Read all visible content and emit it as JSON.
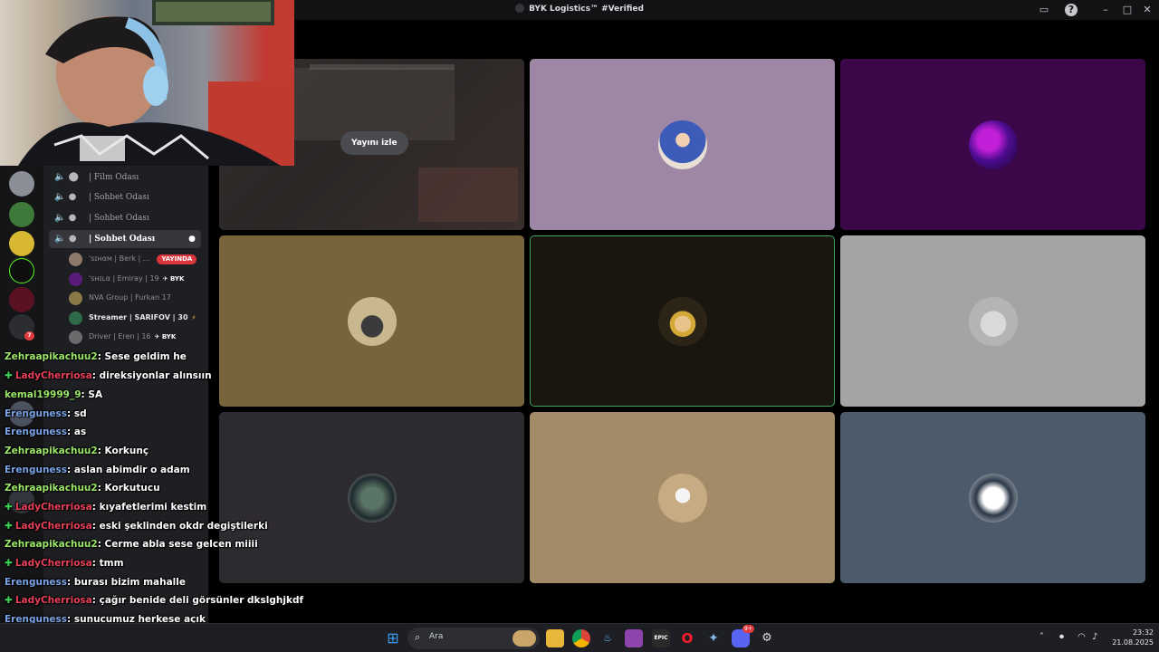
{
  "window": {
    "title": "BYK Logistics™ #Verified"
  },
  "stage": {
    "watch_label": "Yayını izle"
  },
  "sidebar": {
    "channels": [
      {
        "label": "| Film Odası"
      },
      {
        "label": "| Sohbet Odası"
      },
      {
        "label": "| Sohbet Odası"
      },
      {
        "label": "| Sohbet Odası"
      }
    ],
    "members": [
      {
        "name": "'sɪнαм | Berk | ...",
        "badge": "YAYINDA"
      },
      {
        "name": "'sʜɪʟα | Emiray | 19",
        "tag": "✈ BYK"
      },
      {
        "name": "NVA Group | Furkan 17"
      },
      {
        "name": "Streamer | SARIFOV | 30",
        "tag": "⚡"
      },
      {
        "name": "Driver | Eren | 16",
        "tag": "✈ BYK"
      }
    ]
  },
  "chat": [
    {
      "user": "Zehraapikachuu2",
      "text": ": Sese geldim he",
      "color": "green",
      "plus": false
    },
    {
      "user": "LadyCherriosa",
      "text": ": direksiyonlar alınsıın",
      "color": "red",
      "plus": true
    },
    {
      "user": "kemal19999_9",
      "text": ": SA",
      "color": "green",
      "plus": false
    },
    {
      "user": "Erenguness",
      "text": ": sd",
      "color": "blue",
      "plus": false
    },
    {
      "user": "Erenguness",
      "text": ": as",
      "color": "blue",
      "plus": false
    },
    {
      "user": "Zehraapikachuu2",
      "text": ": Korkunç",
      "color": "green",
      "plus": false
    },
    {
      "user": "Erenguness",
      "text": ": aslan abimdir o adam",
      "color": "blue",
      "plus": false
    },
    {
      "user": "Zehraapikachuu2",
      "text": ": Korkutucu",
      "color": "green",
      "plus": false
    },
    {
      "user": "LadyCherriosa",
      "text": ": kıyafetlerimi kestim",
      "color": "red",
      "plus": true
    },
    {
      "user": "LadyCherriosa",
      "text": ": eski şeklinden okdr degiştilerki",
      "color": "red",
      "plus": true
    },
    {
      "user": "Zehraapikachuu2",
      "text": ": Cerme abla sese gelcen miiii",
      "color": "green",
      "plus": false
    },
    {
      "user": "LadyCherriosa",
      "text": ": tmm",
      "color": "red",
      "plus": true
    },
    {
      "user": "Erenguness",
      "text": ": burası bizim mahalle",
      "color": "blue",
      "plus": false
    },
    {
      "user": "LadyCherriosa",
      "text": ": çağır benide deli görsünler dkslghjkdf",
      "color": "red",
      "plus": true
    },
    {
      "user": "Erenguness",
      "text": ": sunucumuz herkese açık",
      "color": "blue",
      "plus": false
    }
  ],
  "taskbar": {
    "search_placeholder": "Ara",
    "time": "23:32",
    "date": "21.08.2025",
    "discord_badge": "9+"
  },
  "colors": {
    "tile_lilac": "#9d87a5",
    "tile_purple": "#3b0748",
    "tile_olive": "#77643a",
    "tile_dark": "#19160f",
    "tile_grey": "#a4a4a4",
    "tile_charcoal": "#2e2b30",
    "tile_tan": "#a48b68",
    "tile_slate": "#4c5b6b",
    "speaking": "#3ba55c"
  }
}
